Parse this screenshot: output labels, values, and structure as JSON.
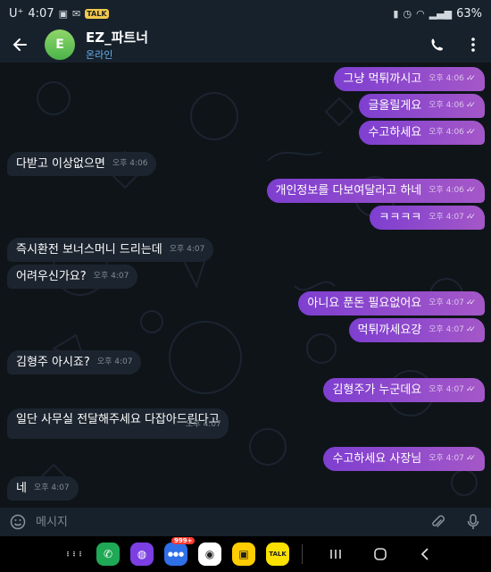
{
  "status": {
    "carrier": "U⁺",
    "time": "4:07",
    "battery": "63%",
    "badge": "TALK"
  },
  "header": {
    "avatar_letter": "E",
    "title": "EZ_파트너",
    "subtitle": "온라인"
  },
  "messages": [
    {
      "dir": "out",
      "text": "그냥 먹튀까시고",
      "time": "오후 4:06"
    },
    {
      "dir": "out",
      "text": "글올릴게요",
      "time": "오후 4:06"
    },
    {
      "dir": "out",
      "text": "수고하세요",
      "time": "오후 4:06"
    },
    {
      "dir": "in",
      "text": "다받고 이상없으면",
      "time": "오후 4:06"
    },
    {
      "dir": "out",
      "text": "개인정보를 다보여달라고 하네",
      "time": "오후 4:06"
    },
    {
      "dir": "out",
      "text": "ㅋㅋㅋㅋ",
      "time": "오후 4:07"
    },
    {
      "dir": "in",
      "text": "즉시환전 보너스머니 드리는데",
      "time": "오후 4:07"
    },
    {
      "dir": "in",
      "text": "어려우신가요?",
      "time": "오후 4:07"
    },
    {
      "dir": "out",
      "text": "아니요 푼돈 필요없어요",
      "time": "오후 4:07"
    },
    {
      "dir": "out",
      "text": "먹튀까세요걍",
      "time": "오후 4:07"
    },
    {
      "dir": "in",
      "text": "김형주 아시죠?",
      "time": "오후 4:07"
    },
    {
      "dir": "out",
      "text": "김형주가 누군데요",
      "time": "오후 4:07"
    },
    {
      "dir": "in",
      "text": "일단 사무실 전달해주세요 다잡아드린다고",
      "time": "오후 4:07"
    },
    {
      "dir": "out",
      "text": "수고하세요 사장님",
      "time": "오후 4:07"
    },
    {
      "dir": "in",
      "text": "네",
      "time": "오후 4:07"
    }
  ],
  "composer": {
    "placeholder": "메시지"
  },
  "nav": {
    "apps": [
      {
        "name": "grid-icon",
        "color": "#000000",
        "label": "⋮⋮⋮"
      },
      {
        "name": "phone-app-icon",
        "color": "#1fa855",
        "label": "✆"
      },
      {
        "name": "internet-app-icon",
        "color": "#7b3fe4",
        "label": "◍"
      },
      {
        "name": "messages-app-icon",
        "color": "#2f6fe8",
        "label": "●●●",
        "badge": "999+"
      },
      {
        "name": "camera-app-icon",
        "color": "#ffffff",
        "label": "◉"
      },
      {
        "name": "kakaopage-app-icon",
        "color": "#ffcd00",
        "label": "▣"
      },
      {
        "name": "kakaotalk-app-icon",
        "color": "#fae100",
        "label": "TALK"
      }
    ]
  },
  "colors": {
    "outgoing_start": "#7e3fd0",
    "outgoing_end": "#a457c7",
    "incoming": "#1c252f",
    "header": "#17212b",
    "accent": "#6ab2f2"
  }
}
